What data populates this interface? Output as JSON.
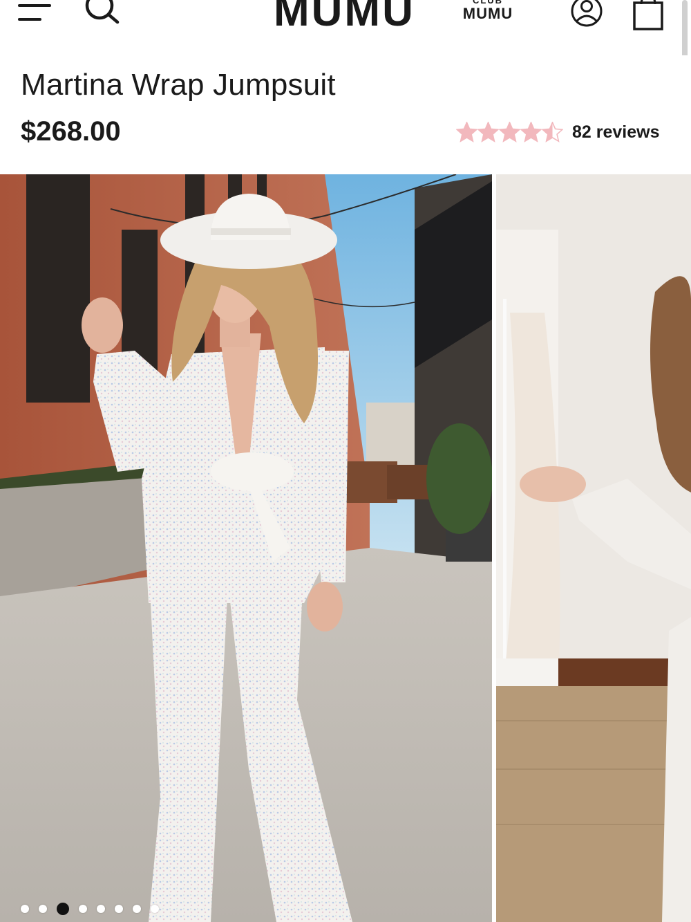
{
  "header": {
    "brand": "MUMU",
    "club_small": "CLUB",
    "club_big": "MUMU",
    "menu_icon": "hamburger-menu-icon",
    "search_icon": "search-icon",
    "account_icon": "user-account-icon",
    "bag_icon": "shopping-bag-icon"
  },
  "product": {
    "name": "Martina Wrap Jumpsuit",
    "price": "$268.00",
    "rating": 4.5,
    "rating_max": 5,
    "reviews_label": "82 reviews",
    "star_color": "#f2b8bd",
    "star_empty_color": "#f2b8bd"
  },
  "gallery": {
    "image_count": 8,
    "active_index": 2,
    "images": [
      {
        "icon": "product-photo-street"
      },
      {
        "icon": "product-photo-studio"
      }
    ]
  },
  "colors": {
    "text": "#1a1a1a",
    "background": "#ffffff",
    "accent_star": "#f2b8bd"
  }
}
